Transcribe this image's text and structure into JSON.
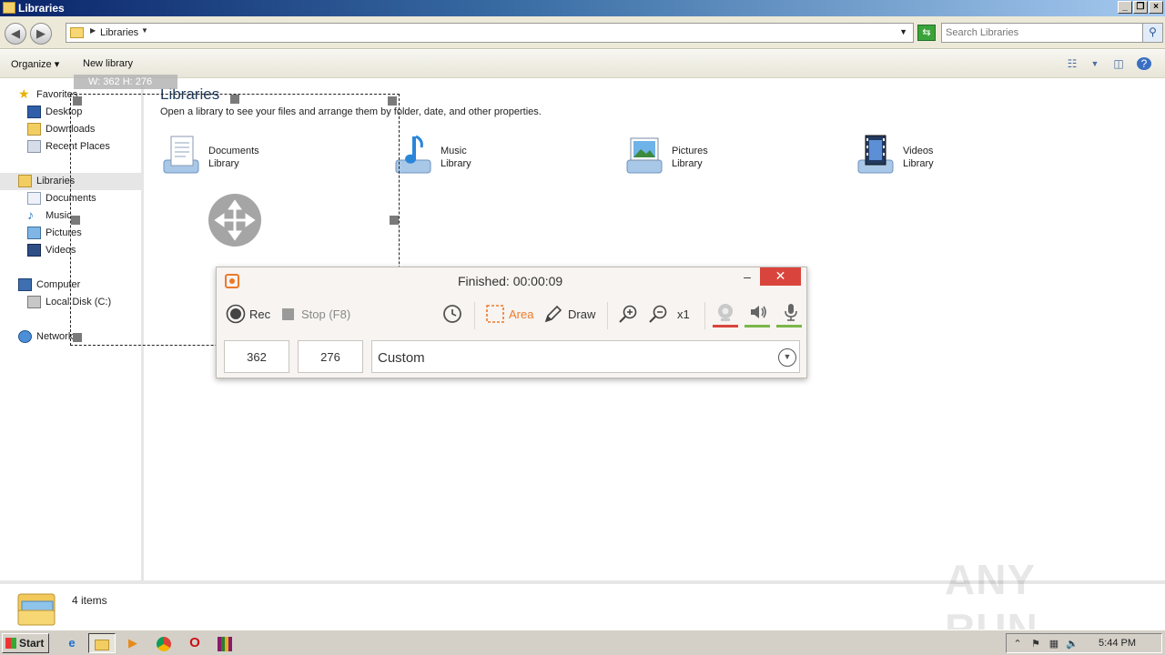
{
  "window": {
    "title": "Libraries"
  },
  "address": {
    "crumb": "Libraries",
    "search_placeholder": "Search Libraries"
  },
  "toolbar": {
    "organize": "Organize",
    "new_library": "New library"
  },
  "nav": {
    "favorites": "Favorites",
    "desktop": "Desktop",
    "downloads": "Downloads",
    "recent": "Recent Places",
    "libraries": "Libraries",
    "documents": "Documents",
    "music": "Music",
    "pictures": "Pictures",
    "videos": "Videos",
    "computer": "Computer",
    "local_disk": "Local Disk (C:)",
    "network": "Network"
  },
  "content": {
    "heading": "Libraries",
    "subtitle": "Open a library to see your files and arrange them by folder, date, and other properties.",
    "libraries": [
      {
        "name": "Documents",
        "kind": "Library"
      },
      {
        "name": "Music",
        "kind": "Library"
      },
      {
        "name": "Pictures",
        "kind": "Library"
      },
      {
        "name": "Videos",
        "kind": "Library"
      }
    ]
  },
  "status": {
    "items": "4 items"
  },
  "selection": {
    "dimensions": "W: 362 H: 276"
  },
  "recorder": {
    "status": "Finished:  00:00:09",
    "rec": "Rec",
    "stop": "Stop (F8)",
    "area": "Area",
    "draw": "Draw",
    "zoom": "x1",
    "width": "362",
    "height": "276",
    "preset": "Custom",
    "colors": {
      "accent": "#ec7a2c",
      "close": "#d9453c",
      "webcam_line": "#d9453c",
      "audio_line": "#7ab648"
    }
  },
  "taskbar": {
    "start": "Start",
    "clock": "5:44 PM"
  },
  "watermark": "ANY RUN"
}
